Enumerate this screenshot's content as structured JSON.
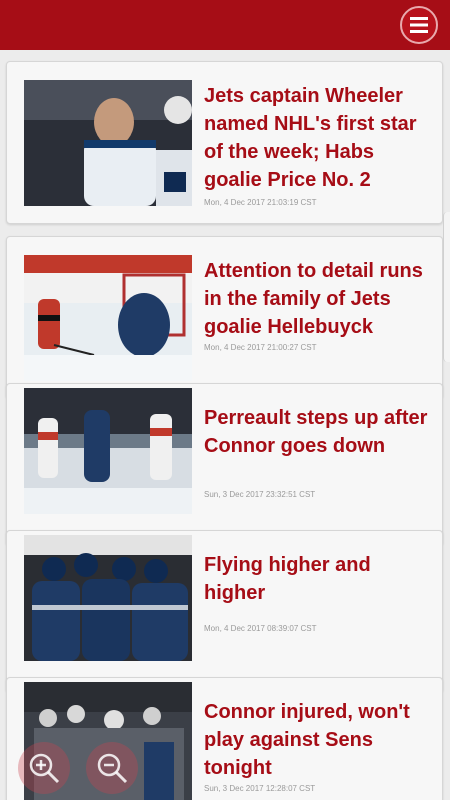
{
  "app_bar": {
    "brand_color": "#a60d16",
    "menu_icon": "hamburger-menu-icon"
  },
  "articles": [
    {
      "headline": "Jets captain Wheeler named NHL's first star of the week; Habs goalie Price No. 2",
      "timestamp": "Mon, 4 Dec 2017 21:03:19 CST"
    },
    {
      "headline": "Attention to detail runs in the family of Jets goalie Hellebuyck",
      "timestamp": "Mon, 4 Dec 2017 21:00:27 CST"
    },
    {
      "headline": "Perreault steps up after Connor goes down",
      "timestamp": "Sun, 3 Dec 2017 23:32:51 CST"
    },
    {
      "headline": "Flying higher and higher",
      "timestamp": "Mon, 4 Dec 2017 08:39:07 CST"
    },
    {
      "headline": "Connor injured, won't play against Sens tonight",
      "timestamp": "Sun, 3 Dec 2017 12:28:07 CST"
    }
  ],
  "zoom_controls": {
    "zoom_in_icon": "zoom-in-icon",
    "zoom_out_icon": "zoom-out-icon"
  }
}
